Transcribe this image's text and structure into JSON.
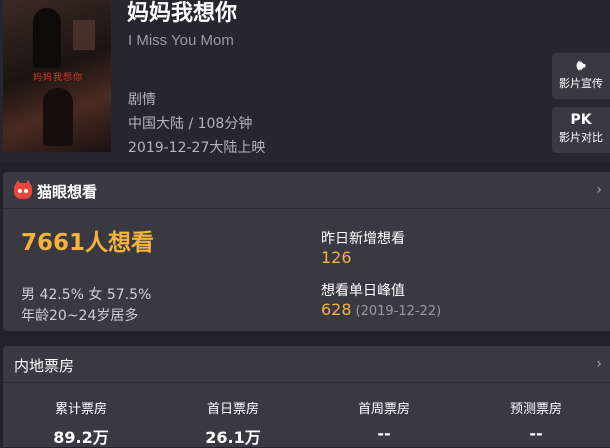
{
  "movie": {
    "title": "妈妈我想你",
    "en_title": "I Miss You Mom",
    "genre": "剧情",
    "meta": "中国大陆 / 108分钟",
    "release": "2019-12-27大陆上映",
    "poster_text": "妈妈我想你"
  },
  "side_buttons": {
    "promo": {
      "icon": "speaker-icon",
      "icon_glyph": "🕪",
      "label": "影片宣传"
    },
    "pk": {
      "icon_text": "PK",
      "label": "影片对比"
    }
  },
  "want": {
    "section_title": "猫眼想看",
    "total": "7661人想看",
    "gender": "男 42.5% 女 57.5%",
    "age": "年龄20~24岁居多",
    "yesterday_label": "昨日新增想看",
    "yesterday_value": "126",
    "peak_label": "想看单日峰值",
    "peak_value": "628",
    "peak_date": "(2019-12-22)"
  },
  "box_office": {
    "section_title": "内地票房",
    "columns": [
      {
        "label": "累计票房",
        "value": "89.2万"
      },
      {
        "label": "首日票房",
        "value": "26.1万"
      },
      {
        "label": "首周票房",
        "value": "--"
      },
      {
        "label": "预测票房",
        "value": "--"
      }
    ]
  },
  "icons": {
    "chevron": "›"
  },
  "colors": {
    "accent": "#f4b33a",
    "brand_red": "#e8483b",
    "bg": "#23222b",
    "card": "#3a3942"
  }
}
